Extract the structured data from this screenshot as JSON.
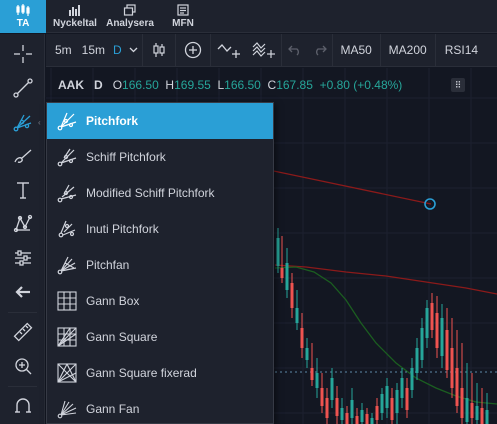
{
  "top_tabs": [
    {
      "label": "TA",
      "icon": "ta-chart-icon",
      "active": true
    },
    {
      "label": "Nyckeltal",
      "icon": "bar-chart-icon",
      "active": false
    },
    {
      "label": "Analysera",
      "icon": "windows-icon",
      "active": false
    },
    {
      "label": "MFN",
      "icon": "news-icon",
      "active": false
    }
  ],
  "chart_toolbar": {
    "timeframes": [
      "5m",
      "15m",
      "D"
    ],
    "indicators": [
      "MA50",
      "MA200",
      "RSI14"
    ]
  },
  "legend": {
    "symbol": "AAK",
    "interval": "D",
    "open_label": "O",
    "open": "166.50",
    "high_label": "H",
    "high": "169.55",
    "low_label": "L",
    "low": "166.50",
    "close_label": "C",
    "close": "167.85",
    "change": "+0.80 (+0.48%)",
    "menu_glyph": "⠿"
  },
  "pitchfork_menu": {
    "items": [
      {
        "label": "Pitchfork",
        "icon": "pitchfork-icon",
        "active": true
      },
      {
        "label": "Schiff Pitchfork",
        "icon": "schiff-pitchfork-icon",
        "active": false
      },
      {
        "label": "Modified Schiff Pitchfork",
        "icon": "modified-schiff-pitchfork-icon",
        "active": false
      },
      {
        "label": "Inuti Pitchfork",
        "icon": "inside-pitchfork-icon",
        "active": false
      },
      {
        "label": "Pitchfan",
        "icon": "pitchfan-icon",
        "active": false
      },
      {
        "label": "Gann Box",
        "icon": "gann-box-icon",
        "active": false
      },
      {
        "label": "Gann Square",
        "icon": "gann-square-icon",
        "active": false
      },
      {
        "label": "Gann Square fixerad",
        "icon": "gann-square-fixed-icon",
        "active": false
      },
      {
        "label": "Gann Fan",
        "icon": "gann-fan-icon",
        "active": false
      }
    ]
  },
  "colors": {
    "accent": "#2a9fd6",
    "up": "#26a69a",
    "down": "#ef5350",
    "ma50": "#1b5e20",
    "ma200": "#8b1a1a",
    "background": "#131722",
    "panel": "#1e222d"
  }
}
